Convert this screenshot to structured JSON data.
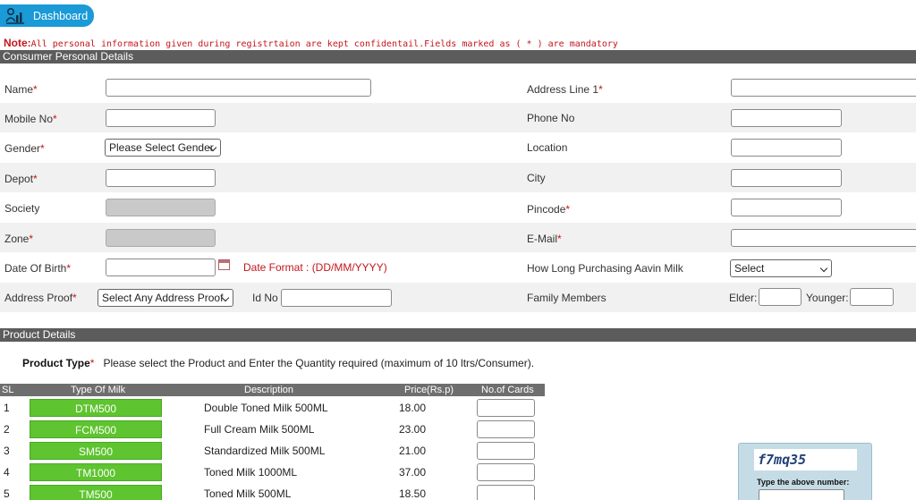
{
  "header": {
    "dashboard_label": "Dashboard"
  },
  "note": {
    "title": "Note:",
    "text": "All personal information given during registrtaion are kept confidentail.Fields marked as ( * ) are mandatory"
  },
  "personal": {
    "section_title": "Consumer Personal Details",
    "required_mark": "*",
    "name_label": "Name",
    "mobile_label": "Mobile No",
    "gender_label": "Gender",
    "gender_value": "Please Select Gender",
    "depot_label": "Depot",
    "society_label": "Society",
    "zone_label": "Zone",
    "dob_label": "Date Of Birth",
    "date_format": "Date Format : (DD/MM/YYYY)",
    "address_proof_label": "Address Proof",
    "address_proof_value": "Select Any Address Proof",
    "id_no_label": "Id No",
    "address1_label": "Address Line 1",
    "phone_label": "Phone No",
    "location_label": "Location",
    "city_label": "City",
    "pincode_label": "Pincode",
    "email_label": "E-Mail",
    "purchasing_label": "How Long Purchasing Aavin Milk",
    "purchasing_value": "Select",
    "family_label": "Family Members",
    "elder_label": "Elder:",
    "younger_label": "Younger:"
  },
  "product": {
    "section_title": "Product Details",
    "type_label": "Product Type",
    "instruction": "Please select the Product and Enter the Quantity required (maximum of 10 ltrs/Consumer).",
    "columns": [
      "SL",
      "Type Of Milk",
      "Description",
      "Price(Rs.p)",
      "No.of Cards"
    ],
    "rows": [
      {
        "sl": "1",
        "code": "DTM500",
        "description": "Double Toned Milk 500ML",
        "price": "18.00"
      },
      {
        "sl": "2",
        "code": "FCM500",
        "description": "Full Cream Milk 500ML",
        "price": "23.00"
      },
      {
        "sl": "3",
        "code": "SM500",
        "description": "Standardized Milk 500ML",
        "price": "21.00"
      },
      {
        "sl": "4",
        "code": "TM1000",
        "description": "Toned Milk 1000ML",
        "price": "37.00"
      },
      {
        "sl": "5",
        "code": "TM500",
        "description": "Toned Milk 500ML",
        "price": "18.50"
      }
    ]
  },
  "captcha": {
    "code": "f7mq35",
    "label": "Type the above number:"
  },
  "colors": {
    "accent": "#1a9ad6",
    "required": "#c4161c",
    "section_bar": "#5c5c5c",
    "product_button": "#5ec42f"
  }
}
